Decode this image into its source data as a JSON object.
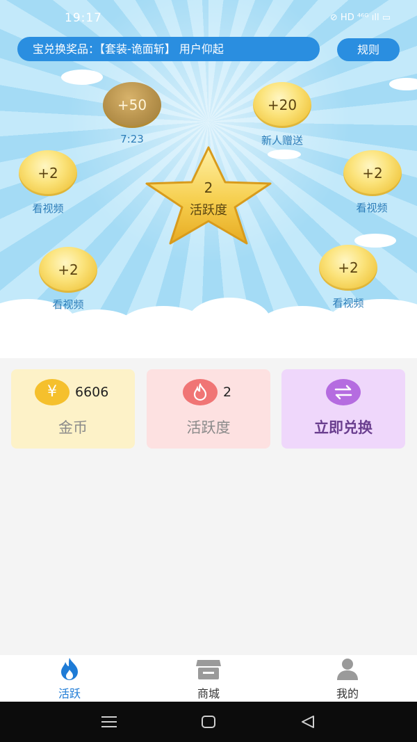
{
  "status_bar": {
    "time": "19:17",
    "icons": "⊘ HD ⁴⁶ᴳ ıll ▭"
  },
  "marquee": {
    "text": "宝兑换奖品：【套装-诡面斩】 用户仰起"
  },
  "rules_button": {
    "label": "规则"
  },
  "coins": [
    {
      "value": "+50",
      "label": "7:23",
      "state": "countdown"
    },
    {
      "value": "+20",
      "label": "新人赠送"
    },
    {
      "value": "+2",
      "label": "看视频"
    },
    {
      "value": "+2",
      "label": "看视频"
    },
    {
      "value": "+2",
      "label": "看视频"
    },
    {
      "value": "+2",
      "label": "看视频"
    }
  ],
  "star": {
    "value": "2",
    "label": "活跃度"
  },
  "stats": {
    "gold": {
      "icon": "yen-icon",
      "value": "6606",
      "label": "金币",
      "color": "#f5c02d"
    },
    "activity": {
      "icon": "flame-icon",
      "value": "2",
      "label": "活跃度",
      "color": "#f07575"
    },
    "exchange": {
      "icon": "exchange-icon",
      "label": "立即兑换",
      "color": "#b56ce0"
    }
  },
  "nav": {
    "items": [
      {
        "label": "活跃",
        "icon": "flame-icon",
        "active": true
      },
      {
        "label": "商城",
        "icon": "store-icon",
        "active": false
      },
      {
        "label": "我的",
        "icon": "user-icon",
        "active": false
      }
    ],
    "active_color": "#1e7bd6"
  },
  "system_nav": {
    "icons": [
      "menu-icon",
      "home-icon",
      "back-icon"
    ]
  }
}
